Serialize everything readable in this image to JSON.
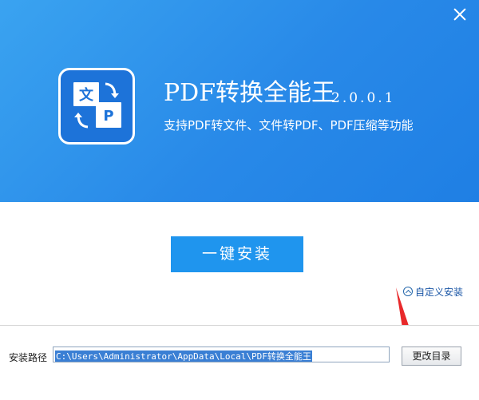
{
  "banner": {
    "close_icon": "close-icon",
    "logo": {
      "glyph_left": "文",
      "glyph_right": "P",
      "icon": "file-convert-icon"
    },
    "title": "PDF转换全能王",
    "version": "2.0.0.1",
    "subtitle": "支持PDF转文件、文件转PDF、PDF压缩等功能"
  },
  "main": {
    "install_button": "一键安装",
    "custom_install": "自定义安装",
    "custom_install_icon": "chevron-up-circle-icon"
  },
  "footer": {
    "path_label": "安装路径",
    "path_value": "C:\\Users\\Administrator\\AppData\\Local\\PDF转换全能王",
    "change_dir_button": "更改目录"
  },
  "colors": {
    "banner": "#2889e8",
    "install_button": "#1f95ee",
    "link": "#1a56a6",
    "annotation": "#e8292b"
  }
}
